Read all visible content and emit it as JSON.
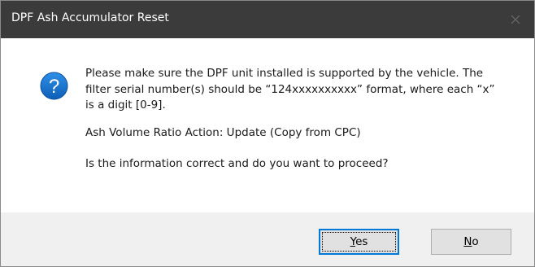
{
  "dialog": {
    "title": "DPF Ash Accumulator Reset",
    "icon": "question-icon",
    "accent_color": "#0078d7",
    "message": {
      "line1": "Please make sure the DPF unit installed is supported by the vehicle. The",
      "line2": "filter serial number(s) should be “124xxxxxxxxxx” format, where each “x”",
      "line3": "is a digit [0-9].",
      "action": "Ash Volume Ratio Action: Update (Copy from CPC)",
      "question": "Is the information correct and do you want to proceed?"
    },
    "buttons": {
      "yes_mnemonic": "Y",
      "yes_rest": "es",
      "no_mnemonic": "N",
      "no_rest": "o"
    }
  }
}
